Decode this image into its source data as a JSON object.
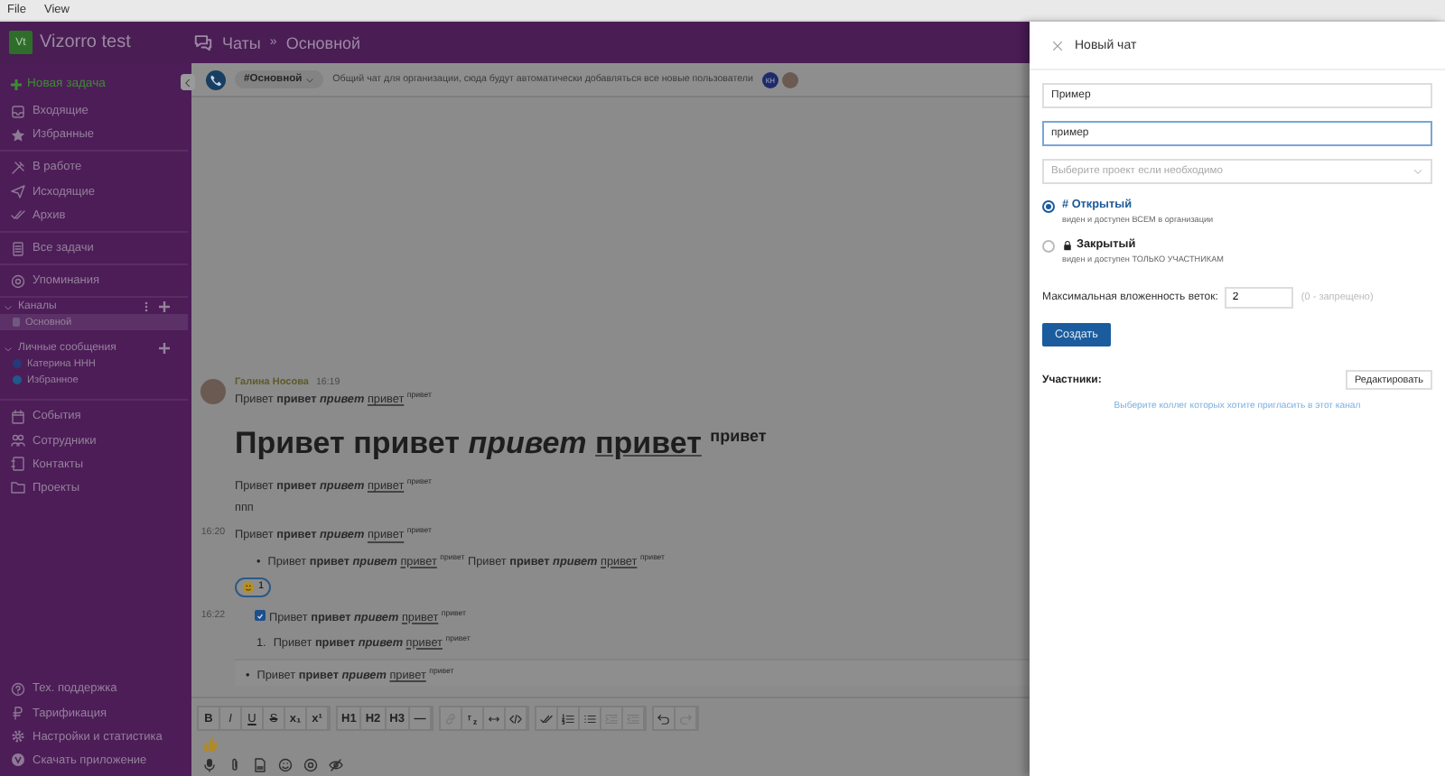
{
  "menu_bar": [
    "File",
    "View"
  ],
  "app": {
    "logo": "Vt",
    "workspace": "Vizorro test"
  },
  "breadcrumb": {
    "section": "Чаты",
    "separator": "»",
    "current": "Основной"
  },
  "sidebar": {
    "new_task": "Новая задача",
    "groups": [
      [
        "Входящие",
        "Избранные"
      ],
      [
        "В работе",
        "Исходящие",
        "Архив"
      ],
      [
        "Все задачи"
      ],
      [
        "Упоминания"
      ]
    ],
    "channels": {
      "title": "Каналы",
      "items": [
        {
          "label": "Основной",
          "selected": true
        }
      ]
    },
    "direct": {
      "title": "Личные сообщения",
      "items": [
        {
          "label": "Катерина ННН",
          "selected": false
        },
        {
          "label": "Избранное",
          "selected": false
        }
      ]
    },
    "links": [
      "События",
      "Сотрудники",
      "Контакты",
      "Проекты"
    ],
    "footer": [
      "Тех. поддержка",
      "Тарификация",
      "Настройки и статистика",
      "Скачать приложение"
    ]
  },
  "chat_header": {
    "channel": "#Основной",
    "description": "Общий чат для организации, сюда будут автоматически добавляться все новые пользователи",
    "member_initials": "КН"
  },
  "messages": [
    {
      "author": "Галина Носова",
      "time": "16:19",
      "blocks": [
        {
          "kind": "p",
          "segments": [
            {
              "kind": "plain",
              "text": "Привет"
            },
            {
              "kind": "bold",
              "text": "привет"
            },
            {
              "kind": "bolditalic",
              "text": "привет"
            },
            {
              "kind": "underline",
              "text": "привет"
            },
            {
              "kind": "sup",
              "text": "привет"
            }
          ]
        },
        {
          "kind": "h1",
          "segments": [
            {
              "kind": "plain",
              "text": "Привет"
            },
            {
              "kind": "plain",
              "text": "привет"
            },
            {
              "kind": "italic",
              "text": "привет"
            },
            {
              "kind": "underline",
              "text": "привет"
            },
            {
              "kind": "sup",
              "text": "привет"
            }
          ]
        },
        {
          "kind": "p",
          "segments": [
            {
              "kind": "plain",
              "text": "Привет"
            },
            {
              "kind": "bold",
              "text": "привет"
            },
            {
              "kind": "bolditalic",
              "text": "привет"
            },
            {
              "kind": "underline",
              "text": "привет"
            },
            {
              "kind": "sup",
              "text": "привет"
            }
          ]
        },
        {
          "kind": "p",
          "segments": [
            {
              "kind": "plain",
              "text": "ппп"
            }
          ]
        }
      ]
    },
    {
      "time": "16:20",
      "blocks": [
        {
          "kind": "p",
          "segments": [
            {
              "kind": "plain",
              "text": "Привет"
            },
            {
              "kind": "bold",
              "text": "привет"
            },
            {
              "kind": "bolditalic",
              "text": "привет"
            },
            {
              "kind": "underline",
              "text": "привет"
            },
            {
              "kind": "sup",
              "text": "привет"
            }
          ]
        },
        {
          "kind": "ul",
          "marker": "•",
          "segments": [
            {
              "kind": "plain",
              "text": "Привет"
            },
            {
              "kind": "bold",
              "text": "привет"
            },
            {
              "kind": "bolditalic",
              "text": "привет"
            },
            {
              "kind": "underline",
              "text": "привет"
            },
            {
              "kind": "sup",
              "text": "привет"
            },
            {
              "kind": "plain",
              "text": "Привет"
            },
            {
              "kind": "bold",
              "text": "привет"
            },
            {
              "kind": "bolditalic",
              "text": "привет"
            },
            {
              "kind": "underline",
              "text": "привет"
            },
            {
              "kind": "sup",
              "text": "привет"
            }
          ]
        },
        {
          "kind": "reaction",
          "count": "1"
        }
      ]
    },
    {
      "time": "16:22",
      "blocks": [
        {
          "kind": "task",
          "checked": true,
          "segments": [
            {
              "kind": "plain",
              "text": "Привет"
            },
            {
              "kind": "bold",
              "text": "привет"
            },
            {
              "kind": "bolditalic",
              "text": "привет"
            },
            {
              "kind": "underline",
              "text": "привет"
            },
            {
              "kind": "sup",
              "text": "привет"
            }
          ]
        },
        {
          "kind": "ol",
          "marker": "1.",
          "segments": [
            {
              "kind": "plain",
              "text": "Привет"
            },
            {
              "kind": "bold",
              "text": "привет"
            },
            {
              "kind": "bolditalic",
              "text": "привет"
            },
            {
              "kind": "underline",
              "text": "привет"
            },
            {
              "kind": "sup",
              "text": "привет"
            }
          ]
        },
        {
          "kind": "ul",
          "marker": "•",
          "segments": [
            {
              "kind": "plain",
              "text": "Привет"
            },
            {
              "kind": "bold",
              "text": "привет"
            },
            {
              "kind": "bolditalic",
              "text": "привет"
            },
            {
              "kind": "underline",
              "text": "привет"
            },
            {
              "kind": "sup",
              "text": "привет"
            }
          ]
        }
      ]
    }
  ],
  "toolbar": [
    [
      {
        "kind": "bold",
        "label": "B",
        "disabled": false
      },
      {
        "kind": "italic",
        "label": "I",
        "disabled": false
      },
      {
        "kind": "underline",
        "label": "U",
        "disabled": false
      },
      {
        "kind": "strike",
        "label": "S",
        "disabled": false
      },
      {
        "kind": "text",
        "label": "x₁",
        "disabled": false
      },
      {
        "kind": "text",
        "label": "x¹",
        "disabled": false
      }
    ],
    [
      {
        "kind": "text",
        "label": "H1",
        "disabled": false
      },
      {
        "kind": "text",
        "label": "H2",
        "disabled": false
      },
      {
        "kind": "text",
        "label": "H3",
        "disabled": false
      },
      {
        "kind": "text",
        "label": "—",
        "disabled": false
      }
    ],
    [
      {
        "kind": "link",
        "disabled": true
      },
      {
        "kind": "format",
        "disabled": false
      },
      {
        "kind": "swap",
        "disabled": false
      },
      {
        "kind": "code",
        "disabled": false
      }
    ],
    [
      {
        "kind": "check",
        "disabled": false
      },
      {
        "kind": "ordered",
        "disabled": false
      },
      {
        "kind": "bulleted",
        "disabled": false
      },
      {
        "kind": "indent",
        "disabled": true
      },
      {
        "kind": "outdent",
        "disabled": true
      }
    ],
    [
      {
        "kind": "undo",
        "disabled": false
      },
      {
        "kind": "redo",
        "disabled": true
      }
    ]
  ],
  "new_chat": {
    "title": "Новый чат",
    "fields": [
      {
        "value": "Пример",
        "focused": false
      },
      {
        "value": "пример",
        "focused": true
      }
    ],
    "project_placeholder": "Выберите проект если необходимо",
    "visibility": [
      {
        "kind": "open",
        "label": "# Открытый",
        "description": "виден и доступен ВСЕМ в организации",
        "selected": true
      },
      {
        "kind": "closed",
        "label": "Закрытый",
        "description": "виден и доступен ТОЛЬКО УЧАСТНИКАМ",
        "selected": false
      }
    ],
    "depth_label": "Максимальная вложенность веток:",
    "depth_value": "2",
    "depth_hint": "(0 - запрещено)",
    "create_button": "Создать",
    "members_label": "Участники:",
    "edit_button": "Редактировать",
    "members_hint": "Выберите коллег которых хотите пригласить в этот канал"
  }
}
